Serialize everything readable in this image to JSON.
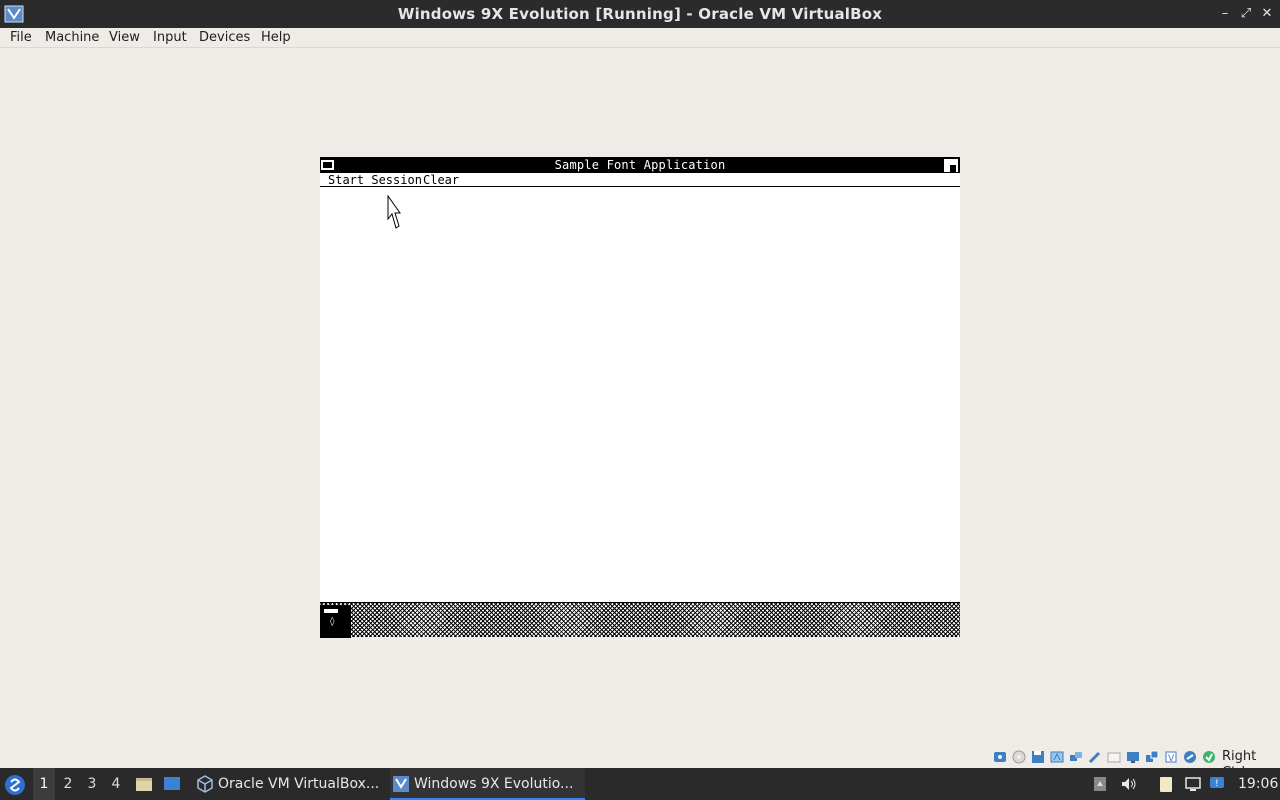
{
  "window": {
    "title": "Windows 9X Evolution [Running] - Oracle VM VirtualBox",
    "controls": [
      "minimize-icon",
      "restore-icon",
      "close-icon"
    ]
  },
  "menubar": {
    "items": [
      "File",
      "Machine",
      "View",
      "Input",
      "Devices",
      "Help"
    ]
  },
  "guest": {
    "title": "Sample Font Application",
    "menu": [
      "Start Session",
      "Clear"
    ]
  },
  "statusbar": {
    "icons": [
      "hard-disk-icon",
      "optical-drive-icon",
      "floppy-icon",
      "audio-icon",
      "network-icon",
      "usb-icon",
      "shared-folders-icon",
      "display-icon",
      "video-capture-icon",
      "cpu-icon",
      "mouse-integration-icon",
      "keyboard-icon"
    ],
    "host_key": "Right Ctrl"
  },
  "taskbar": {
    "workspaces": [
      "1",
      "2",
      "3",
      "4"
    ],
    "active_workspace": "1",
    "tasks": [
      {
        "label": "Oracle VM VirtualBox...",
        "active": false
      },
      {
        "label": "Windows 9X Evolutio...",
        "active": true
      }
    ],
    "clock": "19:06"
  },
  "colors": {
    "titlebar": "#2b2b2b",
    "host_bg": "#efece7",
    "taskbar": "#2a2a2a",
    "task_active_accent": "#3b82f6"
  }
}
